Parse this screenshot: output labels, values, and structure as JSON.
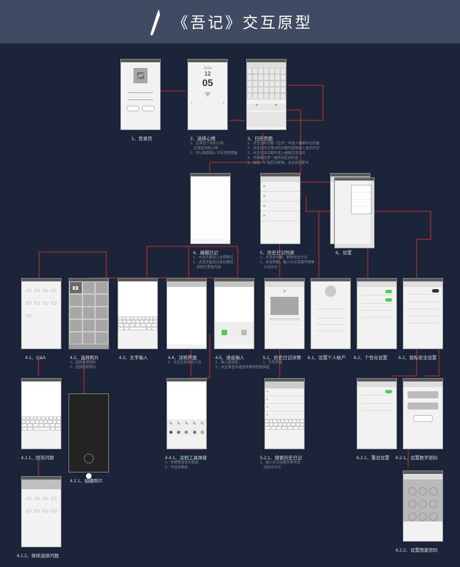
{
  "header": {
    "title": "《吾记》交互原型"
  },
  "screens": {
    "s1": {
      "cap": "1、登录页"
    },
    "s2": {
      "cap": "2、选择心情",
      "date_y": "2016",
      "date_m": "12",
      "date_d": "05",
      "notes": [
        "1、左滑选下张的心情，",
        "　右滑选他张心情",
        "2、可以随意跳入书写规则质面"
      ]
    },
    "s3": {
      "cap": "3、日历页面",
      "notes": [
        "1、点击当时日期（边天）可进入编辑日记页面",
        "2、点击白日记录点的日期可直接进入该天日记",
        "3、点击空白日期可进入编辑过去日记",
        "4、可跳转任意一篇时间区间内进",
        "5、双指一扩随区间变换，点击返回即可"
      ]
    },
    "s4": {
      "cap": "4、编辑日记",
      "notes": [
        "1、点击页面进入全屏模式",
        "2、点击页面选口自动推放",
        "　添加已录音内容"
      ]
    },
    "s5": {
      "cap": "5、历史日记列表",
      "notes": [
        "1、点击后动删、删除但全日记",
        "2、点击搜索，输入日记关键字搜索",
        "　以往日记"
      ]
    },
    "s6": {
      "cap": "6、设置"
    },
    "s41": {
      "cap": "4.1、Q&A"
    },
    "s42": {
      "cap": "4.2、选择照片",
      "notes": [
        "1、选择系统相片",
        "2、选择拍照照片"
      ]
    },
    "s43": {
      "cap": "4.3、文字输入"
    },
    "s44": {
      "cap": "4.4、涂鸦界面",
      "notes": [
        "1、点击右架涂鸿工具"
      ]
    },
    "s45": {
      "cap": "4.5、语音输入",
      "notes": [
        "1、输入层语变：",
        "2、点击录音对语音听着到密码保留"
      ]
    },
    "s51": {
      "cap": "5.1、历史日记详情",
      "notes": [
        "1、与名表首"
      ]
    },
    "s61": {
      "cap": "6.1、设置个人帐户"
    },
    "s62a": {
      "cap": "6.2、个性化设置"
    },
    "s62b": {
      "cap": "6.2、隐私安全设置"
    },
    "s411": {
      "cap": "4.1.1、回答问题"
    },
    "s412": {
      "cap": "4.1.2、继续选择问题"
    },
    "s421": {
      "cap": "4.2.1、拍摄照片"
    },
    "s441": {
      "cap": "4.4.1、涂鸦工具弹窗",
      "notes": [
        "1、可随意自选大壁组",
        "2、可自定稿色"
      ]
    },
    "s521": {
      "cap": "5.2.1、搜索历史日记",
      "notes": [
        "1、输入日记关键字即可自",
        "　动反应日记"
      ]
    },
    "s621": {
      "cap": "6.2.1、重设设置"
    },
    "s621b": {
      "cap": "6.2.1、设置数字密码"
    },
    "s622": {
      "cap": "6.2.2、设置图案密码"
    }
  }
}
